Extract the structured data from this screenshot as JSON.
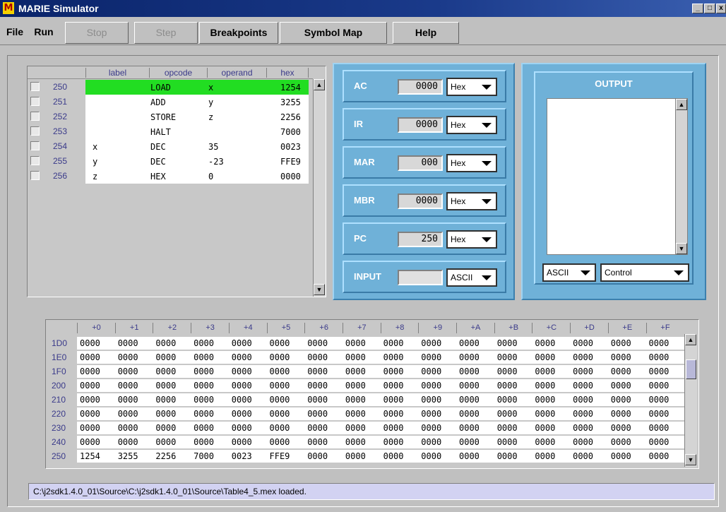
{
  "window": {
    "title": "MARIE Simulator",
    "icon_letter": "M",
    "min_glyph": "_",
    "max_glyph": "□",
    "close_glyph": "x"
  },
  "menu": {
    "file": "File",
    "run": "Run",
    "stop": "Stop",
    "step": "Step",
    "breakpoints": "Breakpoints",
    "symbol_map": "Symbol Map",
    "help": "Help"
  },
  "program": {
    "headers": {
      "label": "label",
      "opcode": "opcode",
      "operand": "operand",
      "hex": "hex"
    },
    "rows": [
      {
        "addr": "250",
        "label": "",
        "opcode": "LOAD",
        "operand": "x",
        "hex": "1254",
        "highlight": true
      },
      {
        "addr": "251",
        "label": "",
        "opcode": "ADD",
        "operand": "y",
        "hex": "3255"
      },
      {
        "addr": "252",
        "label": "",
        "opcode": "STORE",
        "operand": "z",
        "hex": "2256"
      },
      {
        "addr": "253",
        "label": "",
        "opcode": "HALT",
        "operand": "",
        "hex": "7000"
      },
      {
        "addr": "254",
        "label": "x",
        "opcode": "DEC",
        "operand": "35",
        "hex": "0023"
      },
      {
        "addr": "255",
        "label": "y",
        "opcode": "DEC",
        "operand": "-23",
        "hex": "FFE9"
      },
      {
        "addr": "256",
        "label": "z",
        "opcode": "HEX",
        "operand": "0",
        "hex": "0000"
      }
    ]
  },
  "registers": [
    {
      "name": "AC",
      "value": "0000",
      "mode": "Hex"
    },
    {
      "name": "IR",
      "value": "0000",
      "mode": "Hex"
    },
    {
      "name": "MAR",
      "value": "000",
      "mode": "Hex"
    },
    {
      "name": "MBR",
      "value": "0000",
      "mode": "Hex"
    },
    {
      "name": "PC",
      "value": "250",
      "mode": "Hex"
    },
    {
      "name": "INPUT",
      "value": "",
      "mode": "ASCII"
    }
  ],
  "output": {
    "title": "OUTPUT",
    "text": "",
    "mode": "ASCII",
    "control": "Control"
  },
  "memory": {
    "headers": [
      "+0",
      "+1",
      "+2",
      "+3",
      "+4",
      "+5",
      "+6",
      "+7",
      "+8",
      "+9",
      "+A",
      "+B",
      "+C",
      "+D",
      "+E",
      "+F"
    ],
    "rows": [
      {
        "addr": "1D0",
        "cells": [
          "0000",
          "0000",
          "0000",
          "0000",
          "0000",
          "0000",
          "0000",
          "0000",
          "0000",
          "0000",
          "0000",
          "0000",
          "0000",
          "0000",
          "0000",
          "0000"
        ]
      },
      {
        "addr": "1E0",
        "cells": [
          "0000",
          "0000",
          "0000",
          "0000",
          "0000",
          "0000",
          "0000",
          "0000",
          "0000",
          "0000",
          "0000",
          "0000",
          "0000",
          "0000",
          "0000",
          "0000"
        ]
      },
      {
        "addr": "1F0",
        "cells": [
          "0000",
          "0000",
          "0000",
          "0000",
          "0000",
          "0000",
          "0000",
          "0000",
          "0000",
          "0000",
          "0000",
          "0000",
          "0000",
          "0000",
          "0000",
          "0000"
        ]
      },
      {
        "addr": "200",
        "cells": [
          "0000",
          "0000",
          "0000",
          "0000",
          "0000",
          "0000",
          "0000",
          "0000",
          "0000",
          "0000",
          "0000",
          "0000",
          "0000",
          "0000",
          "0000",
          "0000"
        ]
      },
      {
        "addr": "210",
        "cells": [
          "0000",
          "0000",
          "0000",
          "0000",
          "0000",
          "0000",
          "0000",
          "0000",
          "0000",
          "0000",
          "0000",
          "0000",
          "0000",
          "0000",
          "0000",
          "0000"
        ]
      },
      {
        "addr": "220",
        "cells": [
          "0000",
          "0000",
          "0000",
          "0000",
          "0000",
          "0000",
          "0000",
          "0000",
          "0000",
          "0000",
          "0000",
          "0000",
          "0000",
          "0000",
          "0000",
          "0000"
        ]
      },
      {
        "addr": "230",
        "cells": [
          "0000",
          "0000",
          "0000",
          "0000",
          "0000",
          "0000",
          "0000",
          "0000",
          "0000",
          "0000",
          "0000",
          "0000",
          "0000",
          "0000",
          "0000",
          "0000"
        ]
      },
      {
        "addr": "240",
        "cells": [
          "0000",
          "0000",
          "0000",
          "0000",
          "0000",
          "0000",
          "0000",
          "0000",
          "0000",
          "0000",
          "0000",
          "0000",
          "0000",
          "0000",
          "0000",
          "0000"
        ]
      },
      {
        "addr": "250",
        "cells": [
          "1254",
          "3255",
          "2256",
          "7000",
          "0023",
          "FFE9",
          "0000",
          "0000",
          "0000",
          "0000",
          "0000",
          "0000",
          "0000",
          "0000",
          "0000",
          "0000"
        ]
      }
    ]
  },
  "status": "C:\\j2sdk1.4.0_01\\Source\\C:\\j2sdk1.4.0_01\\Source\\Table4_5.mex loaded."
}
